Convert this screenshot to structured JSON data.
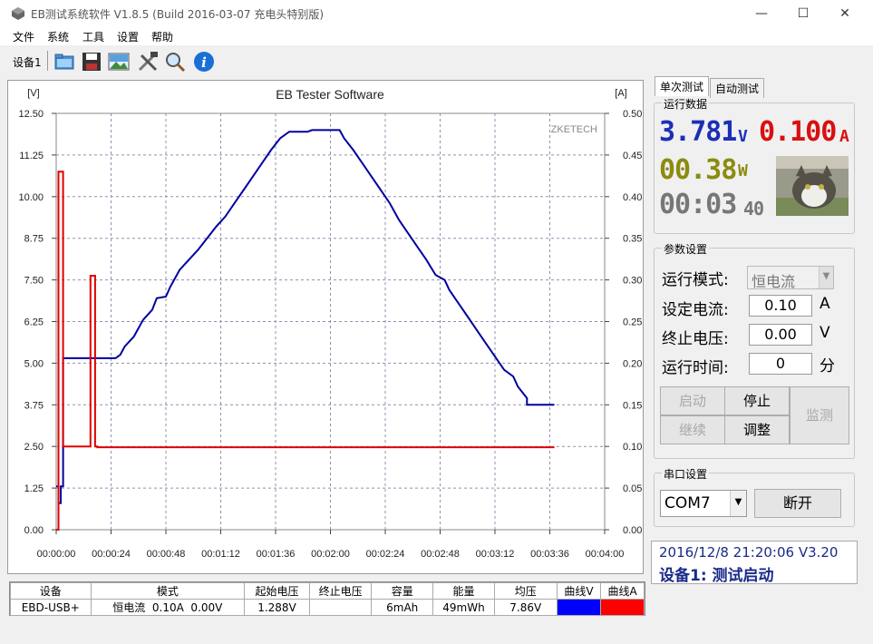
{
  "window": {
    "title": "EB测试系统软件 V1.8.5 (Build 2016-03-07 充电头特别版)",
    "minimize": "—",
    "maximize": "☐",
    "close": "✕"
  },
  "menu": {
    "file": "文件",
    "system": "系统",
    "tools": "工具",
    "settings": "设置",
    "help": "帮助"
  },
  "toolbar": {
    "device": "设备1"
  },
  "chart_data": {
    "type": "line",
    "title": "EB Tester Software",
    "watermark": "ZKETECH",
    "left_unit": "[V]",
    "right_unit": "[A]",
    "y_left_ticks": [
      "0.00",
      "1.25",
      "2.50",
      "3.75",
      "5.00",
      "6.25",
      "7.50",
      "8.75",
      "10.00",
      "11.25",
      "12.50"
    ],
    "y_right_ticks": [
      "0.00",
      "0.05",
      "0.10",
      "0.15",
      "0.20",
      "0.25",
      "0.30",
      "0.35",
      "0.40",
      "0.45",
      "0.50"
    ],
    "x_ticks": [
      "00:00:00",
      "00:00:24",
      "00:00:48",
      "00:01:12",
      "00:01:36",
      "00:02:00",
      "00:02:24",
      "00:02:48",
      "00:03:12",
      "00:03:36",
      "00:04:00"
    ],
    "ylim_left": [
      0,
      12.5
    ],
    "ylim_right": [
      0,
      0.5
    ],
    "xlim_seconds": [
      0,
      240
    ],
    "series": [
      {
        "name": "曲线V",
        "color": "#0000a0",
        "points": [
          [
            0,
            1.3
          ],
          [
            1,
            1.3
          ],
          [
            1,
            0.8
          ],
          [
            2,
            0.8
          ],
          [
            2,
            1.3
          ],
          [
            3,
            1.3
          ],
          [
            3,
            5.15
          ],
          [
            26,
            5.15
          ],
          [
            28,
            5.25
          ],
          [
            30,
            5.5
          ],
          [
            34,
            5.8
          ],
          [
            38,
            6.3
          ],
          [
            42,
            6.6
          ],
          [
            44,
            6.95
          ],
          [
            48,
            7.0
          ],
          [
            50,
            7.3
          ],
          [
            54,
            7.8
          ],
          [
            58,
            8.1
          ],
          [
            62,
            8.4
          ],
          [
            66,
            8.75
          ],
          [
            70,
            9.1
          ],
          [
            74,
            9.4
          ],
          [
            78,
            9.8
          ],
          [
            82,
            10.2
          ],
          [
            86,
            10.6
          ],
          [
            90,
            11.0
          ],
          [
            94,
            11.4
          ],
          [
            98,
            11.75
          ],
          [
            102,
            11.95
          ],
          [
            110,
            11.95
          ],
          [
            112,
            12.0
          ],
          [
            124,
            12.0
          ],
          [
            126,
            11.75
          ],
          [
            130,
            11.4
          ],
          [
            134,
            11.0
          ],
          [
            138,
            10.6
          ],
          [
            142,
            10.2
          ],
          [
            146,
            9.8
          ],
          [
            150,
            9.3
          ],
          [
            154,
            8.9
          ],
          [
            158,
            8.5
          ],
          [
            162,
            8.1
          ],
          [
            166,
            7.65
          ],
          [
            170,
            7.5
          ],
          [
            172,
            7.2
          ],
          [
            176,
            6.8
          ],
          [
            180,
            6.4
          ],
          [
            184,
            6.0
          ],
          [
            188,
            5.6
          ],
          [
            192,
            5.2
          ],
          [
            196,
            4.8
          ],
          [
            200,
            4.6
          ],
          [
            202,
            4.3
          ],
          [
            206,
            3.95
          ],
          [
            206,
            3.75
          ],
          [
            218,
            3.75
          ]
        ]
      },
      {
        "name": "曲线A",
        "color": "#e00000",
        "points": [
          [
            0,
            0.0
          ],
          [
            1,
            0.0
          ],
          [
            1,
            0.43
          ],
          [
            3,
            0.43
          ],
          [
            3,
            0.1
          ],
          [
            15,
            0.1
          ],
          [
            15,
            0.305
          ],
          [
            17,
            0.305
          ],
          [
            17,
            0.1
          ],
          [
            18,
            0.1
          ],
          [
            18,
            0.099
          ],
          [
            218,
            0.099
          ]
        ]
      }
    ]
  },
  "table": {
    "headers": [
      "设备",
      "模式",
      "起始电压",
      "终止电压",
      "容量",
      "能量",
      "均压",
      "曲线V",
      "曲线A"
    ],
    "row": [
      "EBD-USB+",
      "恒电流  0.10A  0.00V",
      "1.288V",
      "",
      "6mAh",
      "49mWh",
      "7.86V",
      "",
      ""
    ],
    "curve_v_color": "#0000ff",
    "curve_a_color": "#ff0000"
  },
  "tabs": {
    "single": "单次测试",
    "auto": "自动测试"
  },
  "run_data": {
    "label": "运行数据",
    "voltage": "3.781",
    "voltage_unit": "V",
    "current": "0.100",
    "current_unit": "A",
    "power": "00.38",
    "power_unit": "W",
    "time_main": "00:03",
    "time_sec": "40"
  },
  "params": {
    "label": "参数设置",
    "mode_label": "运行模式:",
    "mode_value": "恒电流",
    "current_label": "设定电流:",
    "current_value": "0.10",
    "current_unit": "A",
    "end_voltage_label": "终止电压:",
    "end_voltage_value": "0.00",
    "end_voltage_unit": "V",
    "run_time_label": "运行时间:",
    "run_time_value": "0",
    "run_time_unit": "分"
  },
  "buttons": {
    "start": "启动",
    "stop": "停止",
    "continue": "继续",
    "adjust": "调整",
    "monitor": "监测"
  },
  "serial": {
    "label": "串口设置",
    "port": "COM7",
    "disconnect": "断开"
  },
  "status": {
    "line1": "2016/12/8 21:20:06  V3.20",
    "line2": "设备1: 测试启动"
  }
}
